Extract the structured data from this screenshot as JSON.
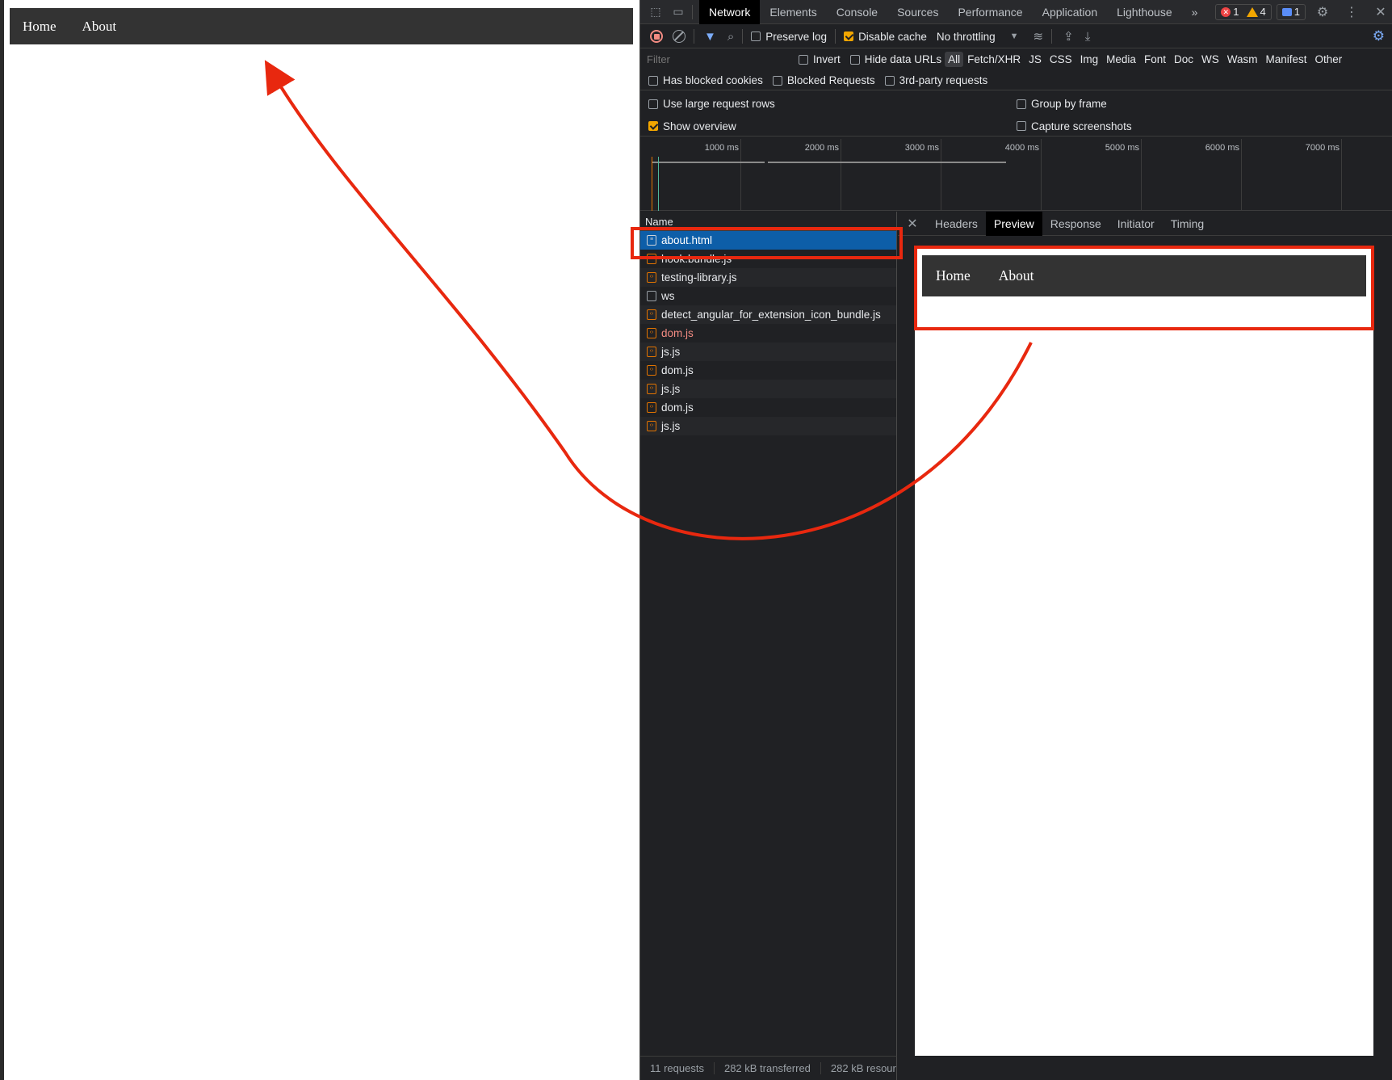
{
  "page": {
    "nav": [
      "Home",
      "About"
    ]
  },
  "devtools": {
    "main_tabs": [
      "Network",
      "Elements",
      "Console",
      "Sources",
      "Performance",
      "Application",
      "Lighthouse"
    ],
    "more_tabs_icon": "chevron-double-right-icon",
    "badges": {
      "errors": "1",
      "warnings": "4",
      "messages": "1"
    },
    "toolbar": {
      "preserve_log": "Preserve log",
      "disable_cache": "Disable cache",
      "throttling": "No throttling"
    },
    "filter": {
      "placeholder": "Filter",
      "invert": "Invert",
      "hide_data_urls": "Hide data URLs",
      "types": [
        "All",
        "Fetch/XHR",
        "JS",
        "CSS",
        "Img",
        "Media",
        "Font",
        "Doc",
        "WS",
        "Wasm",
        "Manifest",
        "Other"
      ]
    },
    "checkboxes": {
      "has_blocked_cookies": "Has blocked cookies",
      "blocked_requests": "Blocked Requests",
      "third_party": "3rd-party requests",
      "large_rows": "Use large request rows",
      "group_by_frame": "Group by frame",
      "show_overview": "Show overview",
      "capture_screenshots": "Capture screenshots"
    },
    "overview_ticks": [
      "1000 ms",
      "2000 ms",
      "3000 ms",
      "4000 ms",
      "5000 ms",
      "6000 ms",
      "7000 ms"
    ],
    "name_header": "Name",
    "requests": [
      {
        "name": "about.html",
        "type": "doc",
        "selected": true
      },
      {
        "name": "hook.bundle.js",
        "type": "script"
      },
      {
        "name": "testing-library.js",
        "type": "script"
      },
      {
        "name": "ws",
        "type": "ws"
      },
      {
        "name": "detect_angular_for_extension_icon_bundle.js",
        "type": "script"
      },
      {
        "name": "dom.js",
        "type": "script",
        "error": true
      },
      {
        "name": "js.js",
        "type": "script"
      },
      {
        "name": "dom.js",
        "type": "script"
      },
      {
        "name": "js.js",
        "type": "script"
      },
      {
        "name": "dom.js",
        "type": "script"
      },
      {
        "name": "js.js",
        "type": "script"
      }
    ],
    "detail_tabs": [
      "Headers",
      "Preview",
      "Response",
      "Initiator",
      "Timing"
    ],
    "preview_nav": [
      "Home",
      "About"
    ],
    "status": {
      "requests": "11 requests",
      "transferred": "282 kB transferred",
      "resources": "282 kB resour"
    }
  },
  "colors": {
    "annotation": "#e8280f",
    "selected_row": "#0d5ea8",
    "nav_bg": "#333333"
  }
}
